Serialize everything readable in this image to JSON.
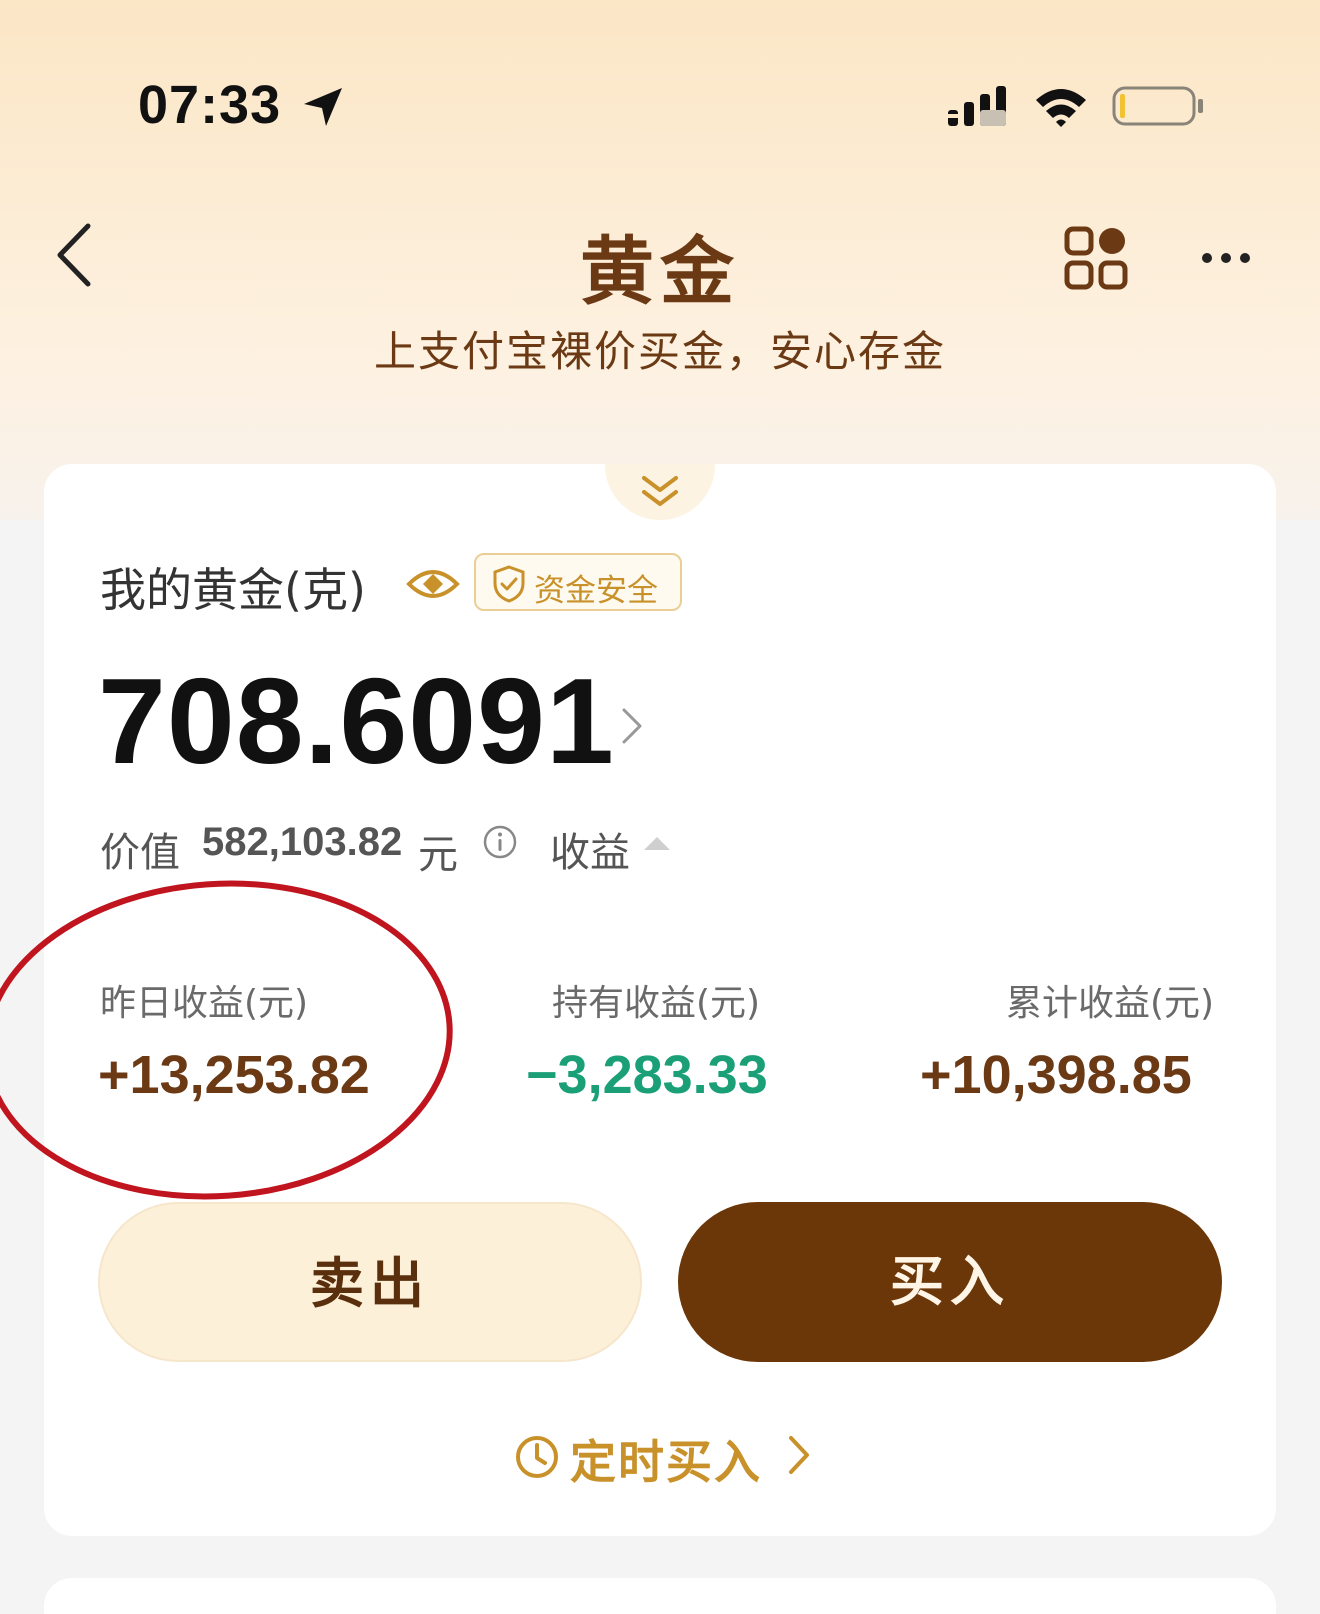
{
  "status_bar": {
    "time": "07:33"
  },
  "nav": {
    "title": "黄金"
  },
  "subtitle": "上支付宝裸价买金，安心存金",
  "holdings": {
    "label": "我的黄金(克)",
    "safety_badge": "资金安全",
    "grams": "708.6091",
    "value_label": "价值",
    "value_amount": "582,103.82",
    "value_unit": "元",
    "profit_toggle": "收益"
  },
  "stats": [
    {
      "label": "昨日收益(元)",
      "value": "+13,253.82"
    },
    {
      "label": "持有收益(元)",
      "value": "−3,283.33"
    },
    {
      "label": "累计收益(元)",
      "value": "+10,398.85"
    }
  ],
  "actions": {
    "sell": "卖出",
    "buy": "买入"
  },
  "schedule": {
    "label": "定时买入"
  },
  "colors": {
    "brand_brown": "#6b3a14",
    "buy_button": "#6b3608",
    "accent_gold": "#c9912a",
    "loss_green": "#1a9f76",
    "annotation_red": "#c0141e"
  }
}
